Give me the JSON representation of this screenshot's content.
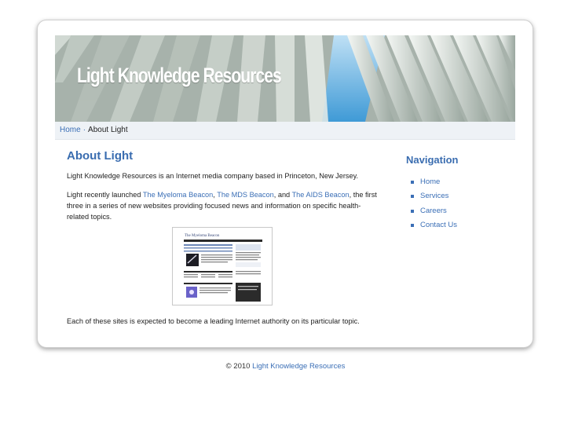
{
  "banner": {
    "title": "Light Knowledge Resources"
  },
  "breadcrumb": {
    "home": "Home",
    "separator": "·",
    "current": "About Light"
  },
  "main": {
    "heading": "About Light",
    "intro": "Light Knowledge Resources is an Internet media company based in Princeton, New Jersey.",
    "launch_prefix": "Light recently launched ",
    "link1": "The Myeloma Beacon",
    "comma1": ", ",
    "link2": "The MDS Beacon",
    "and": ", and ",
    "link3": "The AIDS Beacon",
    "launch_suffix": ", the first three in a series of new websites providing focused news and information on specific health-related topics.",
    "closing": "Each of these sites is expected to become a leading Internet authority on its particular topic."
  },
  "thumbnail": {
    "site_title": "The Myeloma Beacon"
  },
  "nav": {
    "heading": "Navigation",
    "items": [
      {
        "label": "Home"
      },
      {
        "label": "Services"
      },
      {
        "label": "Careers"
      },
      {
        "label": "Contact Us"
      }
    ]
  },
  "footer": {
    "copyright": "© 2010 ",
    "link": "Light Knowledge Resources"
  },
  "colors": {
    "link": "#3b6fb6",
    "heading": "#3a6db0",
    "breadcrumb_bg": "#eef2f6"
  }
}
